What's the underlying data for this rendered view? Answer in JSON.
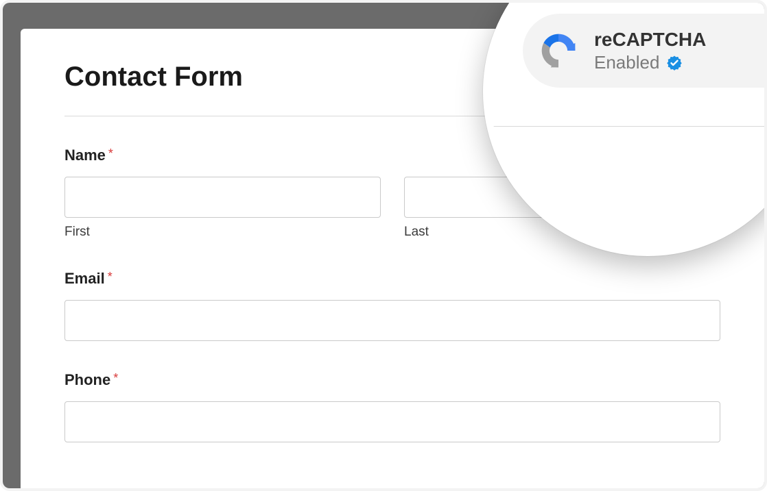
{
  "form": {
    "title": "Contact Form",
    "name_label": "Name",
    "first_label": "First",
    "last_label": "Last",
    "email_label": "Email",
    "phone_label": "Phone",
    "required_mark": "*"
  },
  "callout": {
    "title": "reCAPTCHA",
    "status": "Enabled"
  },
  "colors": {
    "recaptcha_blue": "#4285f4",
    "recaptcha_dark": "#1a73e8",
    "recaptcha_grey": "#a0a0a0",
    "verified_blue": "#1a8fe3",
    "required_red": "#d83a3a"
  }
}
